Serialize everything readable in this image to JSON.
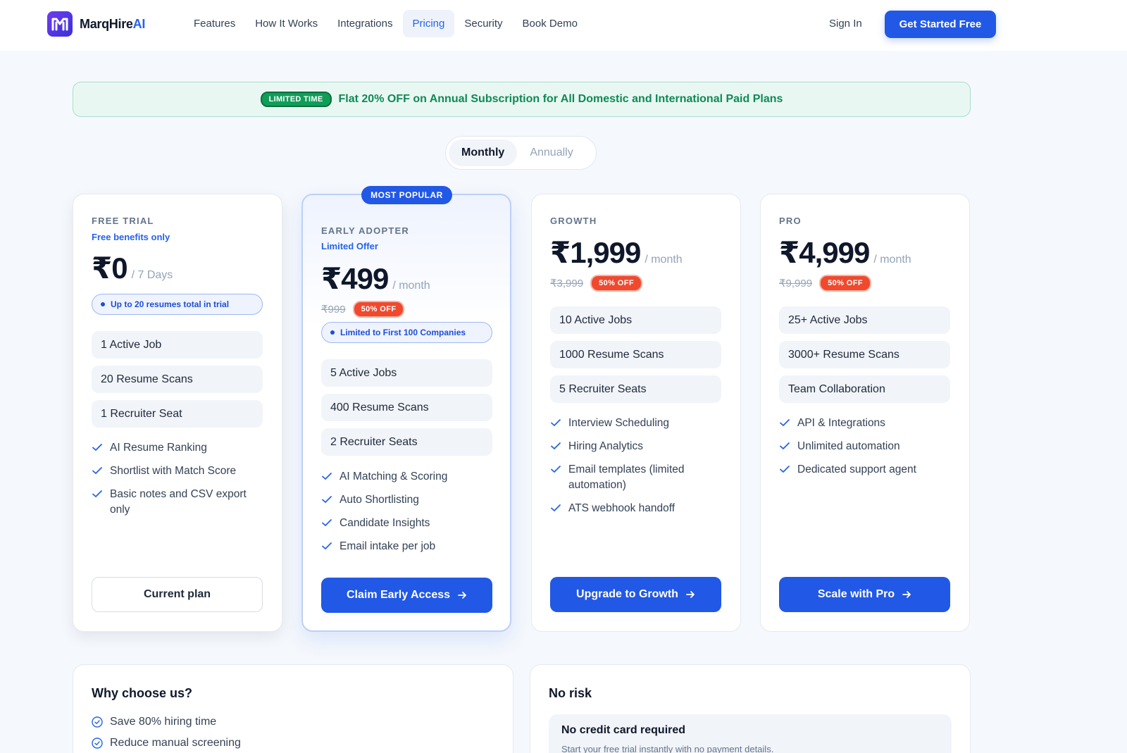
{
  "nav": {
    "logo_text": "MarqHire",
    "logo_ai": "AI",
    "links": [
      "Features",
      "How It Works",
      "Integrations",
      "Pricing",
      "Security",
      "Book Demo"
    ],
    "active_link": "Pricing",
    "sign_in": "Sign In",
    "cta": "Get Started Free"
  },
  "banner": {
    "badge": "LIMITED TIME",
    "text": "Flat 20% OFF on Annual Subscription for All Domestic and International Paid Plans"
  },
  "billing_toggle": {
    "options": [
      "Monthly",
      "Annually"
    ],
    "selected": "Monthly"
  },
  "most_popular": "MOST POPULAR",
  "plans": [
    {
      "tier": "FREE TRIAL",
      "subtitle": "Free benefits only",
      "price": "₹0",
      "period": "/ 7 Days",
      "note": "Up to 20 resumes total in trial",
      "features": [
        "1 Active Job",
        "20 Resume Scans",
        "1 Recruiter Seat"
      ],
      "checks": [
        "AI Resume Ranking",
        "Shortlist with Match Score",
        "Basic notes and CSV export only"
      ],
      "button": "Current plan"
    },
    {
      "tier": "EARLY ADOPTER",
      "subtitle": "Limited Offer",
      "price": "₹499",
      "period": "/ month",
      "was": "₹999",
      "discount": "50% OFF",
      "note": "Limited to First 100 Companies",
      "features": [
        "5 Active Jobs",
        "400 Resume Scans",
        "2 Recruiter Seats"
      ],
      "checks": [
        "AI Matching & Scoring",
        "Auto Shortlisting",
        "Candidate Insights",
        "Email intake per job"
      ],
      "button": "Claim Early Access"
    },
    {
      "tier": "GROWTH",
      "price": "₹1,999",
      "period": "/ month",
      "was": "₹3,999",
      "discount": "50% OFF",
      "features": [
        "10 Active Jobs",
        "1000 Resume Scans",
        "5 Recruiter Seats"
      ],
      "checks": [
        "Interview Scheduling",
        "Hiring Analytics",
        "Email templates (limited automation)",
        "ATS webhook handoff"
      ],
      "button": "Upgrade to Growth"
    },
    {
      "tier": "PRO",
      "price": "₹4,999",
      "period": "/ month",
      "was": "₹9,999",
      "discount": "50% OFF",
      "features": [
        "25+ Active Jobs",
        "3000+ Resume Scans",
        "Team Collaboration"
      ],
      "checks": [
        "API & Integrations",
        "Unlimited automation",
        "Dedicated support agent"
      ],
      "button": "Scale with Pro"
    }
  ],
  "why": {
    "title": "Why choose us?",
    "items": [
      "Save 80% hiring time",
      "Reduce manual screening"
    ]
  },
  "no_risk": {
    "title": "No risk",
    "box_title": "No credit card required",
    "box_desc": "Start your free trial instantly with no payment details."
  },
  "colors": {
    "brand": "#2158e6",
    "discount": "#f0492e",
    "banner_green": "#0f8a55"
  }
}
